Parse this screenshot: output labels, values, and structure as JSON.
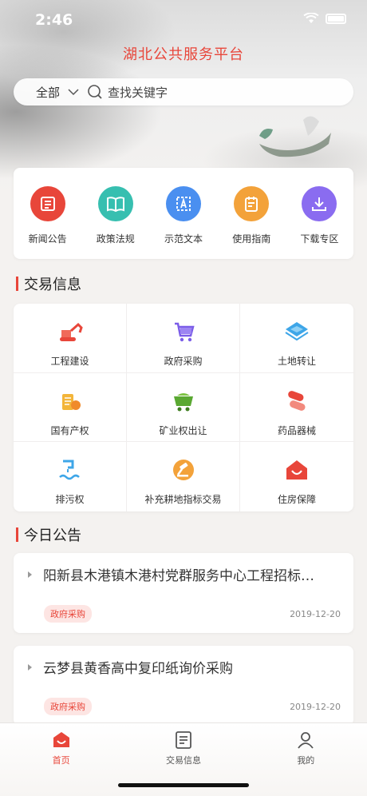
{
  "status": {
    "time": "2:46"
  },
  "header": {
    "title": "湖北公共服务平台"
  },
  "search": {
    "scope": "全部",
    "placeholder": "查找关键字"
  },
  "quick_links": [
    {
      "label": "新闻公告",
      "icon": "news-icon",
      "color": "#e8463a"
    },
    {
      "label": "政策法规",
      "icon": "policy-book-icon",
      "color": "#37bfb0"
    },
    {
      "label": "示范文本",
      "icon": "template-doc-icon",
      "color": "#4a8ff0"
    },
    {
      "label": "使用指南",
      "icon": "guide-icon",
      "color": "#f3a23a"
    },
    {
      "label": "下载专区",
      "icon": "download-icon",
      "color": "#8a6cf0"
    }
  ],
  "trade_section": {
    "title": "交易信息"
  },
  "trade_items": [
    {
      "label": "工程建设",
      "icon": "excavator-icon"
    },
    {
      "label": "政府采购",
      "icon": "shopping-cart-icon"
    },
    {
      "label": "土地转让",
      "icon": "land-plots-icon"
    },
    {
      "label": "国有产权",
      "icon": "property-coins-icon"
    },
    {
      "label": "矿业权出让",
      "icon": "mine-cart-icon"
    },
    {
      "label": "药品器械",
      "icon": "pill-icon"
    },
    {
      "label": "排污权",
      "icon": "discharge-icon"
    },
    {
      "label": "补充耕地指标交易",
      "icon": "gavel-icon"
    },
    {
      "label": "住房保障",
      "icon": "house-icon"
    }
  ],
  "notice_section": {
    "title": "今日公告"
  },
  "notices": [
    {
      "title": "阳新县木港镇木港村党群服务中心工程招标…",
      "tag": "政府采购",
      "date": "2019-12-20"
    },
    {
      "title": "云梦县黄香高中复印纸询价采购",
      "tag": "政府采购",
      "date": "2019-12-20"
    }
  ],
  "tabbar": [
    {
      "label": "首页",
      "icon": "home-icon",
      "active": true
    },
    {
      "label": "交易信息",
      "icon": "trade-info-icon",
      "active": false
    },
    {
      "label": "我的",
      "icon": "profile-icon",
      "active": false
    }
  ],
  "colors": {
    "accent": "#e8463a"
  }
}
